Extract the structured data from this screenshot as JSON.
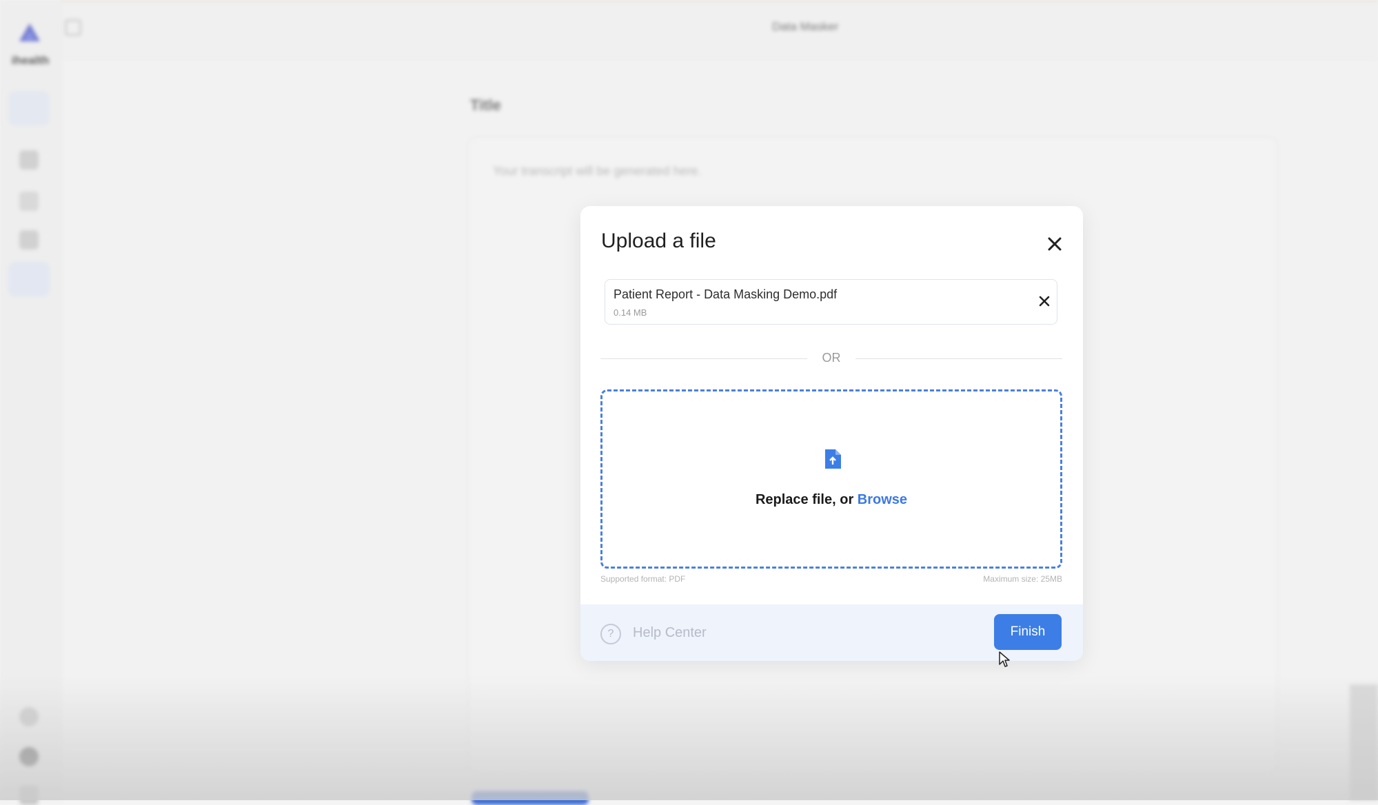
{
  "app": {
    "brand_name": "ihealth",
    "header_title": "Data Masker",
    "title_label": "Title",
    "transcript_placeholder": "Your transcript will be generated here."
  },
  "sidebar": {
    "icons": [
      "cursor-icon",
      "list-icon",
      "chart-icon",
      "chat-icon",
      "key-icon",
      "settings-icon",
      "user-icon",
      "logout-icon"
    ]
  },
  "modal": {
    "title": "Upload a file",
    "file": {
      "name": "Patient Report - Data Masking Demo.pdf",
      "size": "0.14 MB"
    },
    "or_label": "OR",
    "dropzone": {
      "prefix": "Replace file, or ",
      "browse_label": "Browse"
    },
    "hints": {
      "supported": "Supported format: PDF",
      "max_size": "Maximum size: 25MB"
    },
    "footer": {
      "help_label": "Help Center",
      "finish_label": "Finish"
    }
  },
  "colors": {
    "accent": "#3c7ee6",
    "footer_bg": "#eef3fc",
    "dropzone_border": "#4a7fe0"
  }
}
